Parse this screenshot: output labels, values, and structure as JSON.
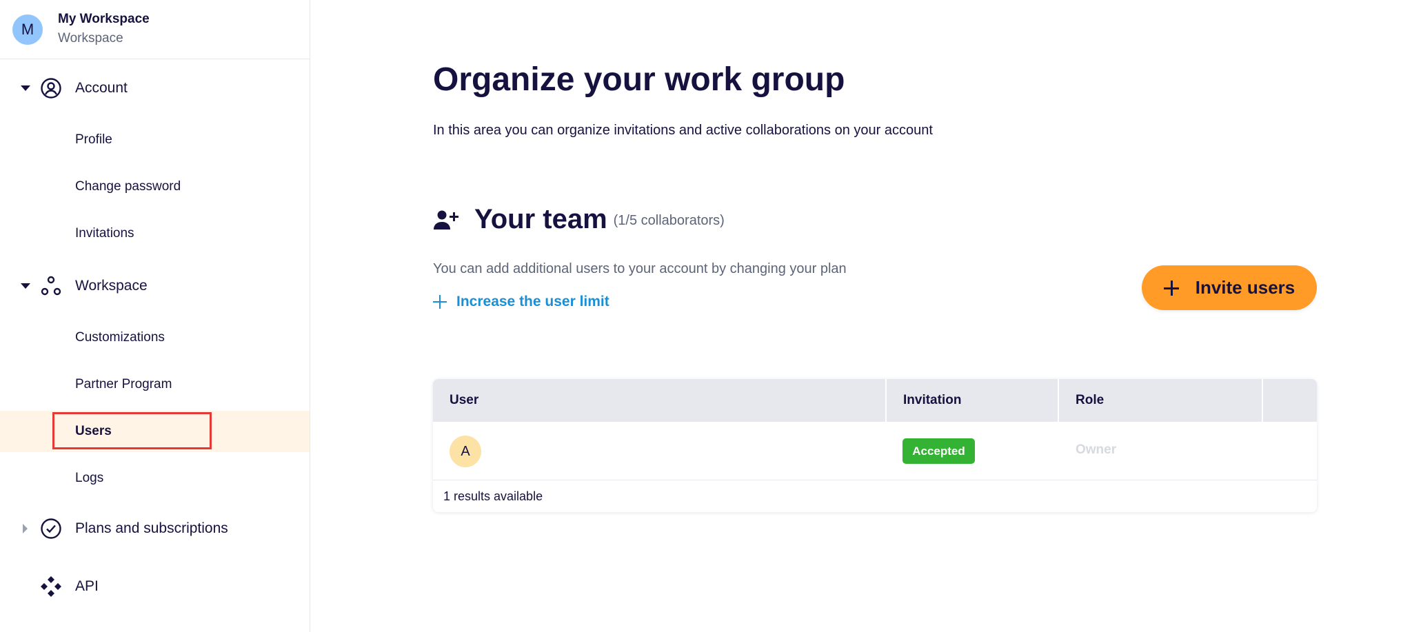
{
  "workspace": {
    "avatar_letter": "M",
    "name": "My Workspace",
    "subtitle": "Workspace"
  },
  "sidebar": {
    "groups": [
      {
        "label": "Account",
        "icon": "user-circle-icon",
        "expanded": true
      },
      {
        "label": "Workspace",
        "icon": "nodes-icon",
        "expanded": true
      },
      {
        "label": "Plans and subscriptions",
        "icon": "check-circle-icon",
        "expanded": false
      },
      {
        "label": "API",
        "icon": "api-diamonds-icon",
        "expanded": null
      }
    ],
    "account_items": [
      {
        "label": "Profile"
      },
      {
        "label": "Change password"
      },
      {
        "label": "Invitations"
      }
    ],
    "workspace_items": [
      {
        "label": "Customizations"
      },
      {
        "label": "Partner Program"
      },
      {
        "label": "Users",
        "active": true
      },
      {
        "label": "Logs"
      }
    ]
  },
  "main": {
    "title": "Organize your work group",
    "description": "In this area you can organize invitations and active collaborations on your account",
    "team": {
      "title": "Your team",
      "count": "(1/5 collaborators)",
      "note": "You can add additional users to your account by changing your plan",
      "limit_link": "Increase the user limit",
      "invite_button": "Invite users"
    },
    "table": {
      "headers": [
        "User",
        "Invitation",
        "Role"
      ],
      "rows": [
        {
          "avatar_letter": "A",
          "invitation": "Accepted",
          "role": "Owner"
        }
      ],
      "footer": "1 results available"
    }
  },
  "colors": {
    "accent_orange": "#ff9b26",
    "link_blue": "#1a8fd6",
    "success_green": "#34b233",
    "active_bg": "#fff4e5",
    "text_dark": "#16123f"
  }
}
